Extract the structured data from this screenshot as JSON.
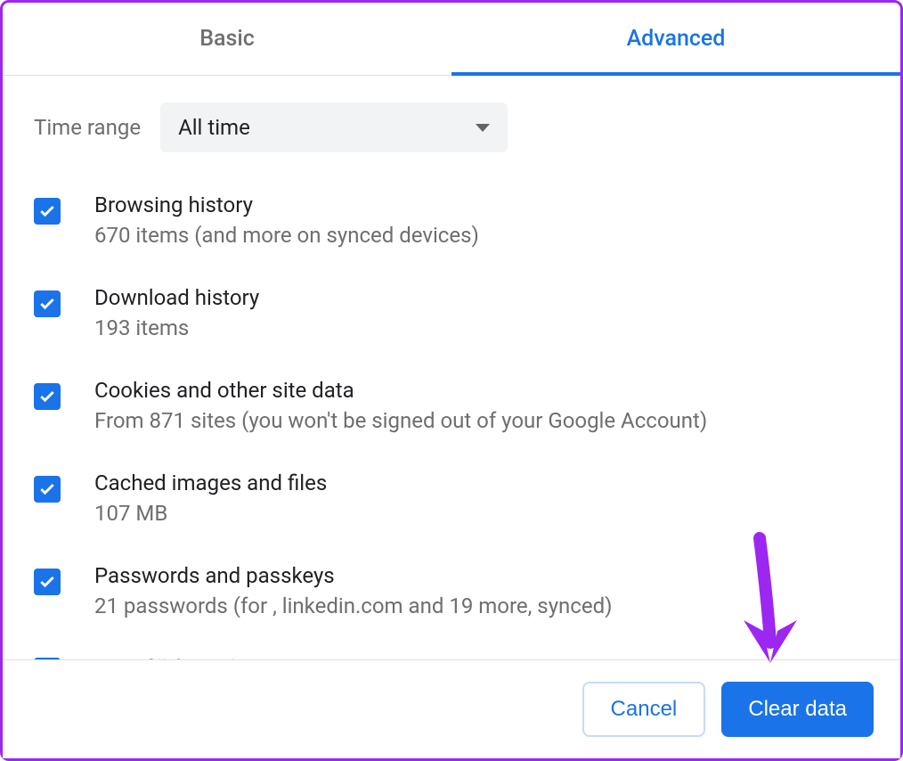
{
  "tabs": {
    "basic": "Basic",
    "advanced": "Advanced"
  },
  "time_range": {
    "label": "Time range",
    "selected": "All time"
  },
  "items": [
    {
      "title": "Browsing history",
      "sub": "670 items (and more on synced devices)"
    },
    {
      "title": "Download history",
      "sub": "193 items"
    },
    {
      "title": "Cookies and other site data",
      "sub": "From 871 sites (you won't be signed out of your Google Account)"
    },
    {
      "title": "Cached images and files",
      "sub": "107 MB"
    },
    {
      "title": "Passwords and passkeys",
      "sub": "21 passwords (for , linkedin.com and 19 more, synced)"
    },
    {
      "title": "Auto-fill form data",
      "sub": ""
    }
  ],
  "buttons": {
    "cancel": "Cancel",
    "clear": "Clear data"
  },
  "colors": {
    "accent": "#1a73e8",
    "annotation": "#9c27f0"
  }
}
